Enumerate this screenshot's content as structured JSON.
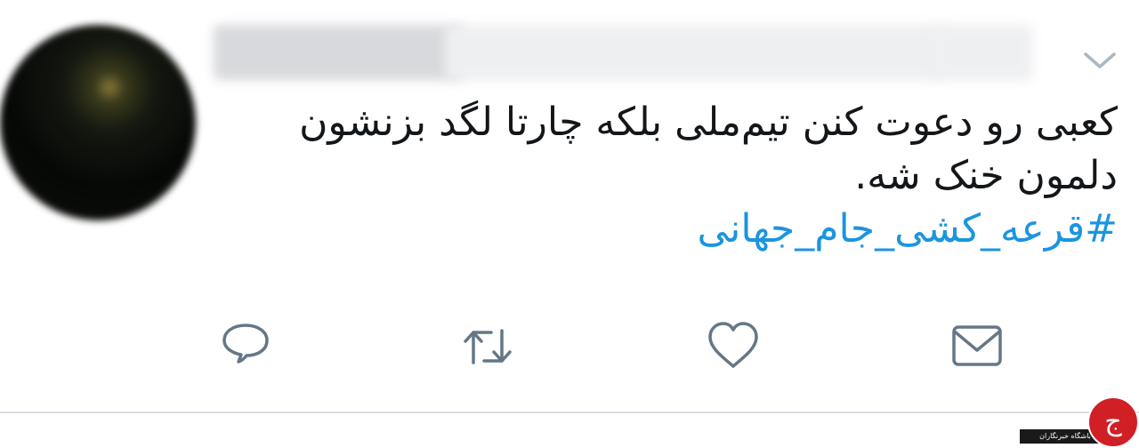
{
  "tweet": {
    "author_display_name": "",
    "author_handle": "",
    "text_lines": [
      "کعبی رو دعوت کنن تیم‌ملی بلکه چارتا لگد بزنشون",
      "دلمون خنک شه."
    ],
    "hashtag": "#قرعه_کشی_جام_جهانی"
  },
  "icons": {
    "menu": "chevron-down-icon",
    "reply": "reply-icon",
    "retweet": "retweet-icon",
    "like": "heart-icon",
    "dm": "envelope-icon"
  },
  "colors": {
    "text": "#14171a",
    "hashtag": "#1b95e0",
    "icon": "#657786",
    "divider": "#d8dde2",
    "watermark_red": "#d11f26"
  },
  "watermark": {
    "label": "باشگاه خبرنگاران",
    "logo_glyph": "ج"
  }
}
